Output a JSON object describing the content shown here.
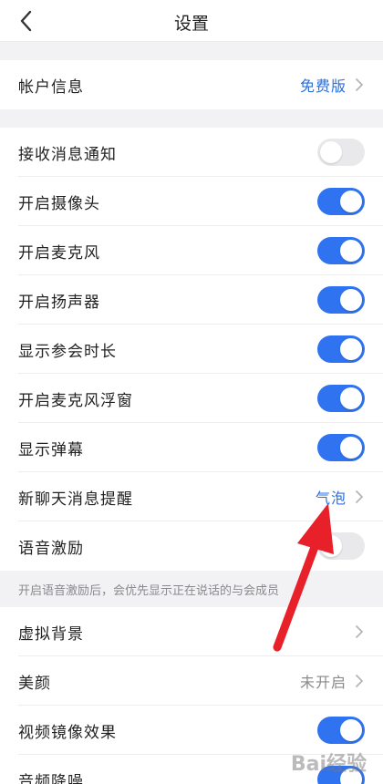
{
  "nav": {
    "title": "设置"
  },
  "account": {
    "label": "帐户信息",
    "value": "免费版"
  },
  "settings": [
    {
      "label": "接收消息通知",
      "on": false
    },
    {
      "label": "开启摄像头",
      "on": true
    },
    {
      "label": "开启麦克风",
      "on": true
    },
    {
      "label": "开启扬声器",
      "on": true
    },
    {
      "label": "显示参会时长",
      "on": true
    },
    {
      "label": "开启麦克风浮窗",
      "on": true
    },
    {
      "label": "显示弹幕",
      "on": true
    }
  ],
  "chat_reminder": {
    "label": "新聊天消息提醒",
    "value": "气泡"
  },
  "voice": {
    "label": "语音激励",
    "on": false,
    "hint": "开启语音激励后，会优先显示正在说话的与会成员"
  },
  "virtual_bg": {
    "label": "虚拟背景"
  },
  "beauty": {
    "label": "美颜",
    "value": "未开启"
  },
  "mirror": {
    "label": "视频镜像效果",
    "on": true
  },
  "noise": {
    "label": "音频降噪",
    "on": true
  },
  "watermark": "Bai经验",
  "colors": {
    "accent": "#2f73f0",
    "annotation_arrow": "#e8202a"
  }
}
